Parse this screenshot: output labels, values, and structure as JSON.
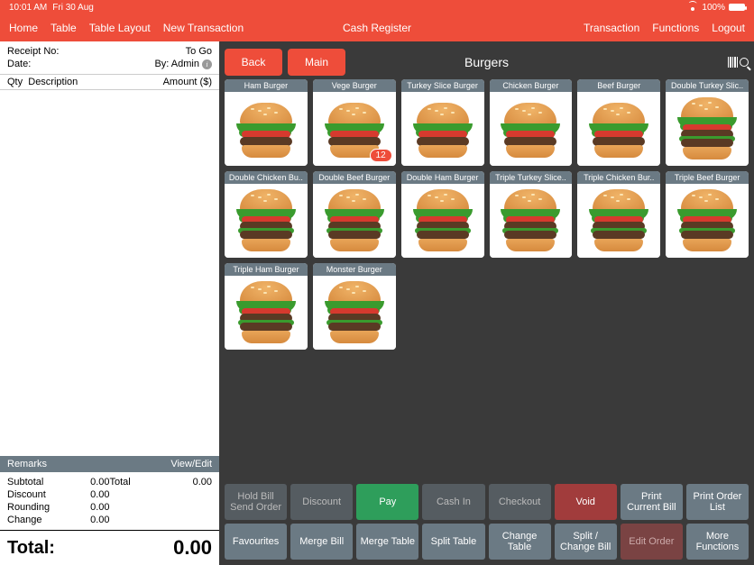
{
  "statusbar": {
    "time": "10:01 AM",
    "date": "Fri 30 Aug",
    "battery": "100%"
  },
  "menu": {
    "left": [
      "Home",
      "Table",
      "Table Layout",
      "New Transaction"
    ],
    "center": "Cash Register",
    "right": [
      "Transaction",
      "Functions",
      "Logout"
    ]
  },
  "receipt": {
    "receipt_no_label": "Receipt No:",
    "order_type": "To Go",
    "date_label": "Date:",
    "by_label": "By: Admin",
    "qty_label": "Qty",
    "desc_label": "Description",
    "amount_label": "Amount ($)",
    "remarks_label": "Remarks",
    "viewedit_label": "View/Edit",
    "subtotal_label": "Subtotal",
    "subtotal": "0.00",
    "discount_label": "Discount",
    "discount": "0.00",
    "rounding_label": "Rounding",
    "rounding": "0.00",
    "change_label": "Change",
    "change": "0.00",
    "total_right_label": "Total",
    "total_right": "0.00",
    "total_label": "Total:",
    "total": "0.00"
  },
  "nav": {
    "back": "Back",
    "main": "Main",
    "category": "Burgers"
  },
  "items": [
    {
      "label": "Ham Burger",
      "tall": false
    },
    {
      "label": "Vege Burger",
      "tall": false,
      "qty": "12"
    },
    {
      "label": "Turkey Slice Burger",
      "tall": false
    },
    {
      "label": "Chicken Burger",
      "tall": false
    },
    {
      "label": "Beef Burger",
      "tall": false
    },
    {
      "label": "Double Turkey Slic..",
      "tall": true
    },
    {
      "label": "Double Chicken Bu..",
      "tall": true
    },
    {
      "label": "Double Beef Burger",
      "tall": true
    },
    {
      "label": "Double Ham Burger",
      "tall": true
    },
    {
      "label": "Triple Turkey Slice..",
      "tall": true
    },
    {
      "label": "Triple Chicken Bur..",
      "tall": true
    },
    {
      "label": "Triple Beef Burger",
      "tall": true
    },
    {
      "label": "Triple Ham Burger",
      "tall": true
    },
    {
      "label": "Monster Burger",
      "tall": true
    }
  ],
  "actions_row1": [
    {
      "label": "Hold Bill\nSend Order",
      "cls": "dis",
      "name": "hold-bill-button"
    },
    {
      "label": "Discount",
      "cls": "dis",
      "name": "discount-button"
    },
    {
      "label": "Pay",
      "cls": "green",
      "name": "pay-button"
    },
    {
      "label": "Cash In",
      "cls": "dis",
      "name": "cash-in-button"
    },
    {
      "label": "Checkout",
      "cls": "dis",
      "name": "checkout-button"
    },
    {
      "label": "Void",
      "cls": "red",
      "name": "void-button"
    },
    {
      "label": "Print\nCurrent Bill",
      "cls": "",
      "name": "print-current-bill-button"
    },
    {
      "label": "Print Order\nList",
      "cls": "",
      "name": "print-order-list-button"
    }
  ],
  "actions_row2": [
    {
      "label": "Favourites",
      "cls": "",
      "name": "favourites-button"
    },
    {
      "label": "Merge Bill",
      "cls": "",
      "name": "merge-bill-button"
    },
    {
      "label": "Merge Table",
      "cls": "",
      "name": "merge-table-button"
    },
    {
      "label": "Split Table",
      "cls": "",
      "name": "split-table-button"
    },
    {
      "label": "Change\nTable",
      "cls": "",
      "name": "change-table-button"
    },
    {
      "label": "Split /\nChange Bill",
      "cls": "",
      "name": "split-change-bill-button"
    },
    {
      "label": "Edit Order",
      "cls": "redd",
      "name": "edit-order-button"
    },
    {
      "label": "More\nFunctions",
      "cls": "",
      "name": "more-functions-button"
    }
  ]
}
